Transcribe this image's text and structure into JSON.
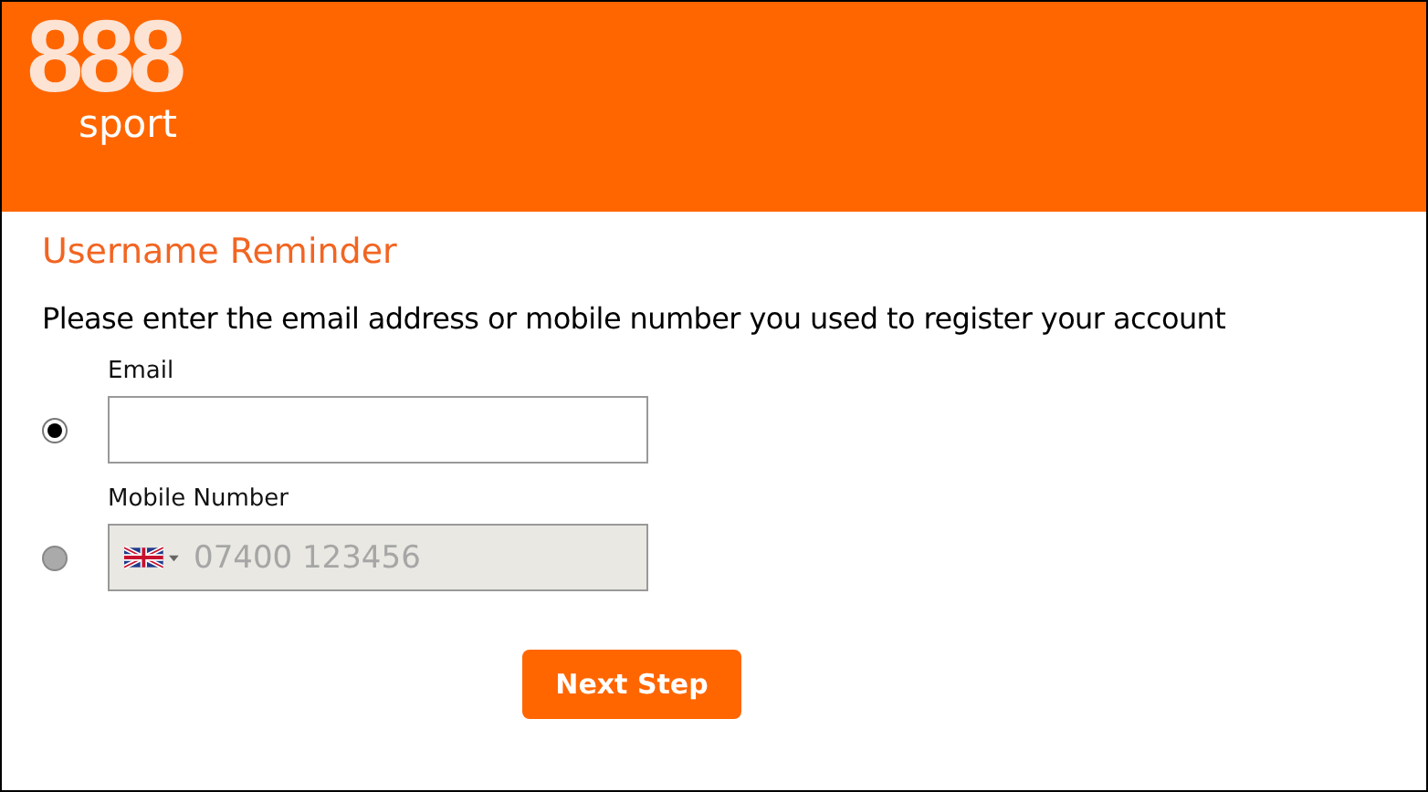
{
  "header": {
    "logo": "888",
    "logo_sub": "sport"
  },
  "title": "Username Reminder",
  "instruction": "Please enter the email address or mobile number you used to register your account",
  "options": [
    {
      "kind": "email",
      "label": "Email",
      "selected": true,
      "disabled": false
    },
    {
      "kind": "mobile",
      "label": "Mobile Number",
      "selected": false,
      "disabled": true,
      "placeholder": "07400 123456"
    }
  ],
  "button": "Next Step"
}
